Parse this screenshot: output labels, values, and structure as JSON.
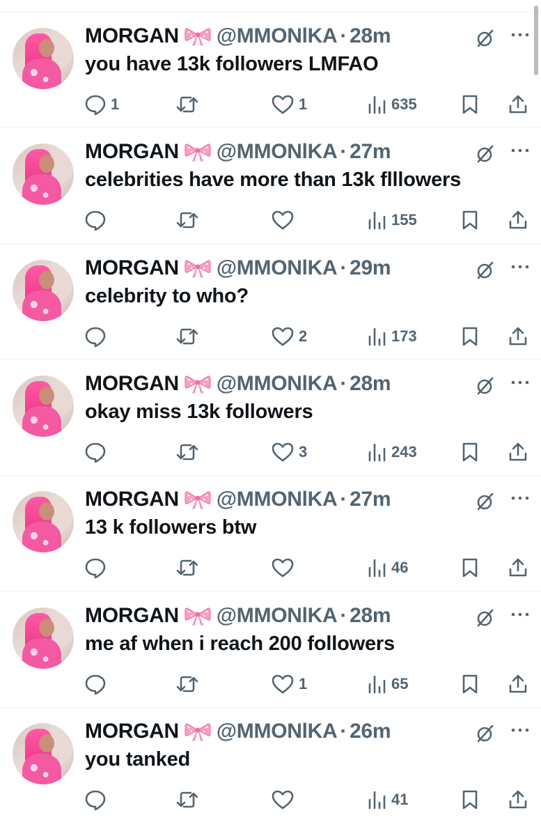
{
  "tweets": [
    {
      "name": "MORGAN",
      "emoji": "🎀",
      "handle": "@MMONlKA",
      "sep": "·",
      "time": "28m",
      "text": "you have 13k followers LMFAO",
      "replies": "1",
      "retweets": "",
      "likes": "1",
      "views": "635"
    },
    {
      "name": "MORGAN",
      "emoji": "🎀",
      "handle": "@MMONlKA",
      "sep": "·",
      "time": "27m",
      "text": "celebrities have more than 13k flllowers",
      "replies": "",
      "retweets": "",
      "likes": "",
      "views": "155"
    },
    {
      "name": "MORGAN",
      "emoji": "🎀",
      "handle": "@MMONlKA",
      "sep": "·",
      "time": "29m",
      "text": "celebrity to who?",
      "replies": "",
      "retweets": "",
      "likes": "2",
      "views": "173"
    },
    {
      "name": "MORGAN",
      "emoji": "🎀",
      "handle": "@MMONlKA",
      "sep": "·",
      "time": "28m",
      "text": "okay miss 13k followers",
      "replies": "",
      "retweets": "",
      "likes": "3",
      "views": "243"
    },
    {
      "name": "MORGAN",
      "emoji": "🎀",
      "handle": "@MMONlKA",
      "sep": "·",
      "time": "27m",
      "text": "13 k followers btw",
      "replies": "",
      "retweets": "",
      "likes": "",
      "views": "46"
    },
    {
      "name": "MORGAN",
      "emoji": "🎀",
      "handle": "@MMONlKA",
      "sep": "·",
      "time": "28m",
      "text": "me af when i reach 200 followers",
      "replies": "",
      "retweets": "",
      "likes": "1",
      "views": "65"
    },
    {
      "name": "MORGAN",
      "emoji": "🎀",
      "handle": "@MMONlKA",
      "sep": "·",
      "time": "26m",
      "text": "you tanked",
      "replies": "",
      "retweets": "",
      "likes": "",
      "views": "41"
    }
  ],
  "icons": {
    "reply": "reply-icon",
    "retweet": "retweet-icon",
    "like": "heart-icon",
    "views": "views-icon",
    "bookmark": "bookmark-icon",
    "share": "share-icon",
    "grok": "grok-icon",
    "more": "more-icon",
    "emoji": "bow-emoji"
  },
  "colors": {
    "text": "#0f1419",
    "secondary": "#536471",
    "divider": "#eff3f4",
    "bow": "#f7a1c4"
  }
}
